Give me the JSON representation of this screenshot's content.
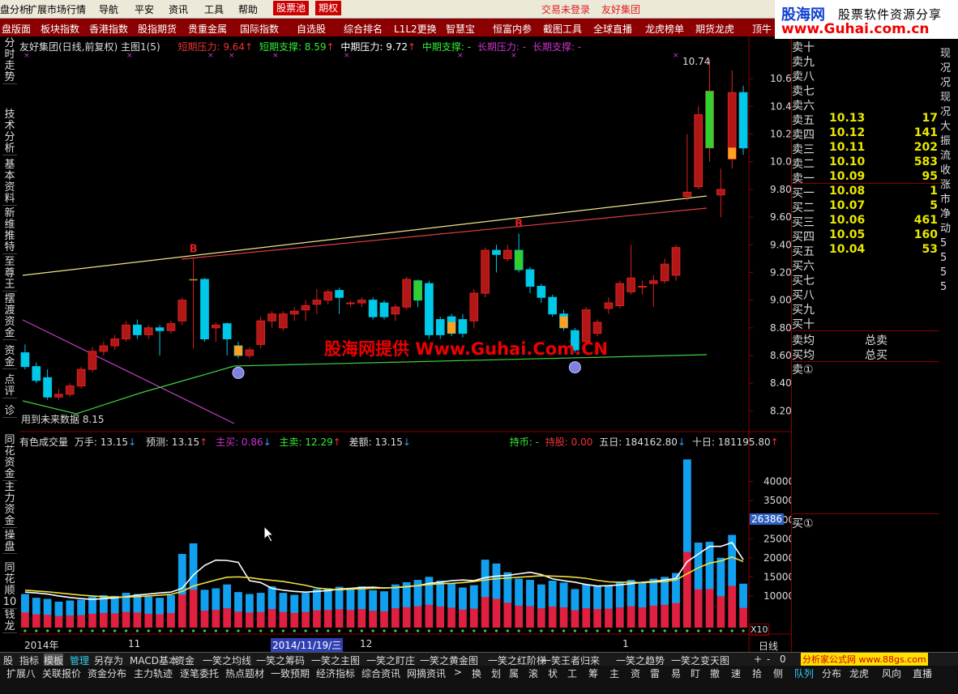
{
  "menubar": {
    "items": [
      "盘分析",
      "扩展市场行情",
      "导航",
      "平安",
      "资讯",
      "工具",
      "帮助",
      "股票池",
      "期权"
    ],
    "status1": "交易未登录",
    "status2": "友好集团"
  },
  "logo": {
    "line1": "股海网",
    "line2": "股票软件资源分享",
    "line3": "www.Guhai.com.cn"
  },
  "tabbar": [
    "盘版面",
    "板块指数",
    "香港指数",
    "股指期货",
    "贵重金属",
    "国际指数",
    "自选股",
    "综合排名",
    "L1L2更换",
    "智慧宝",
    "恒富内参",
    "截图工具",
    "全球直播",
    "龙虎榜单",
    "期货龙虎",
    "顶牛"
  ],
  "leftbar": [
    "分时走势",
    "技术分析",
    "基本资料",
    "新维推特",
    "至尊王",
    "摆渡资金",
    "资金",
    "点评",
    "诊"
  ],
  "leftbar2": [
    "同花资金",
    "主力资金",
    "操盘",
    "同花顺10",
    "钱龙"
  ],
  "chart_header": {
    "title": "友好集团(日线,前复权) 主图1(5)",
    "s1": "短期压力: 9.64",
    "s2": "短期支撑: 8.59",
    "s3": "中期压力: 9.72",
    "s4": "中期支撑: -",
    "s5": "长期压力: -",
    "s6": "长期支撑: -"
  },
  "watermark": "股海网提供 Www.Guhai.Com.CN",
  "bottom_label": "用到未来数据 8.15",
  "max_label": "10.74",
  "b_mark": "B",
  "price_axis": [
    "10.60",
    "10.40",
    "10.20",
    "10.00",
    "9.80",
    "9.60",
    "9.40",
    "9.20",
    "9.00",
    "8.80",
    "8.60",
    "8.40",
    "8.20"
  ],
  "vol_header": {
    "title": "有色成交量",
    "wan": "万手: 13.15",
    "yc": "预测: 13.15",
    "zm": "主买: 0.86",
    "zs": "主卖: 12.29",
    "ce": "差额: 13.15",
    "cb": "持币: -",
    "cg": "持股: 0.00",
    "wr": "五日: 184162.80",
    "sr": "十日: 181195.80"
  },
  "vol_axis": [
    "40000",
    "35000",
    "30000",
    "25000",
    "20000",
    "15000",
    "10000"
  ],
  "vol_tag": "26386",
  "x10": "X10",
  "date_labels": {
    "d1": "2014年",
    "d2": "11",
    "d3": "2014/11/19/三",
    "d4": "12",
    "d5": "1"
  },
  "orderbook": [
    {
      "n": "卖十",
      "p": "",
      "v": ""
    },
    {
      "n": "卖九",
      "p": "",
      "v": ""
    },
    {
      "n": "卖八",
      "p": "",
      "v": ""
    },
    {
      "n": "卖七",
      "p": "",
      "v": ""
    },
    {
      "n": "卖六",
      "p": "",
      "v": ""
    },
    {
      "n": "卖五",
      "p": "10.13",
      "v": "17"
    },
    {
      "n": "卖四",
      "p": "10.12",
      "v": "141"
    },
    {
      "n": "卖三",
      "p": "10.11",
      "v": "202"
    },
    {
      "n": "卖二",
      "p": "10.10",
      "v": "583"
    },
    {
      "n": "卖一",
      "p": "10.09",
      "v": "95"
    },
    {
      "n": "买一",
      "p": "10.08",
      "v": "1"
    },
    {
      "n": "买二",
      "p": "10.07",
      "v": "5"
    },
    {
      "n": "买三",
      "p": "10.06",
      "v": "461"
    },
    {
      "n": "买四",
      "p": "10.05",
      "v": "160"
    },
    {
      "n": "买五",
      "p": "10.04",
      "v": "53"
    },
    {
      "n": "买六",
      "p": "",
      "v": ""
    },
    {
      "n": "买七",
      "p": "",
      "v": ""
    },
    {
      "n": "买八",
      "p": "",
      "v": ""
    },
    {
      "n": "买九",
      "p": "",
      "v": ""
    },
    {
      "n": "买十",
      "p": "",
      "v": ""
    }
  ],
  "avg": {
    "sell": "卖均",
    "buy": "买均",
    "tsell": "总卖",
    "tbuy": "总买",
    "s1": "卖①",
    "b1": "买①"
  },
  "rstrip": "现况况现况大振流收涨市净动5555",
  "bottom1": [
    "股",
    "指标",
    "模板",
    "管理",
    "另存为",
    "MACD基本",
    "资金",
    "一笑之均线",
    "一笑之筹码",
    "一笑之主图",
    "一笑之盯庄",
    "一笑之黄金图",
    "一笑之红阶梯",
    "一笑王者归来",
    "一笑之趋势",
    "一笑之变天图"
  ],
  "bottom1_right": {
    "plus": "+",
    "minus": "-",
    "zero": "0",
    "period": "日线"
  },
  "bottom2": [
    "扩展八",
    "关联报价",
    "资金分布",
    "主力轨迹",
    "逐笔委托",
    "热点题材",
    "一致预期",
    "经济指标",
    "综合资讯",
    "网摘资讯",
    ">",
    "换",
    "划",
    "属",
    "滚",
    "状",
    "工",
    "筹",
    "主",
    "资",
    "雷",
    "易",
    "盯",
    "撤",
    "速",
    "拾",
    "侧",
    "队列",
    "分布",
    "龙虎",
    "风向",
    "直播"
  ],
  "ad": "分析家公式网 www.88gs.com",
  "chart_data": {
    "type": "candlestick",
    "ylim": [
      8.05,
      10.8
    ],
    "candles": [
      [
        8.62,
        8.52,
        8.68,
        8.5
      ],
      [
        8.52,
        8.42,
        8.55,
        8.4
      ],
      [
        8.44,
        8.3,
        8.5,
        8.28
      ],
      [
        8.3,
        8.32,
        8.36,
        8.28
      ],
      [
        8.32,
        8.38,
        8.4,
        8.3
      ],
      [
        8.38,
        8.5,
        8.52,
        8.36
      ],
      [
        8.5,
        8.63,
        8.66,
        8.48
      ],
      [
        8.63,
        8.67,
        8.7,
        8.6
      ],
      [
        8.67,
        8.72,
        8.75,
        8.64
      ],
      [
        8.72,
        8.82,
        8.85,
        8.7
      ],
      [
        8.82,
        8.75,
        8.86,
        8.72
      ],
      [
        8.75,
        8.8,
        8.82,
        8.72
      ],
      [
        8.8,
        8.78,
        8.82,
        8.6
      ],
      [
        8.78,
        8.83,
        8.85,
        8.76
      ],
      [
        8.85,
        9.0,
        9.02,
        8.82
      ],
      [
        9.15,
        9.15,
        9.3,
        8.65
      ],
      [
        9.15,
        8.72,
        9.16,
        8.7
      ],
      [
        8.8,
        8.82,
        8.84,
        8.7
      ],
      [
        8.83,
        8.72,
        8.84,
        8.6
      ],
      [
        8.67,
        8.6,
        8.7,
        8.58
      ],
      [
        8.6,
        8.64,
        8.66,
        8.58
      ],
      [
        8.68,
        8.85,
        8.88,
        8.65
      ],
      [
        8.85,
        8.9,
        8.92,
        8.8
      ],
      [
        8.8,
        8.9,
        8.92,
        8.78
      ],
      [
        8.9,
        8.92,
        8.95,
        8.85
      ],
      [
        8.93,
        8.96,
        9.0,
        8.85
      ],
      [
        8.97,
        9.0,
        9.08,
        8.9
      ],
      [
        9.0,
        9.06,
        9.08,
        8.97
      ],
      [
        9.07,
        9.02,
        9.09,
        8.9
      ],
      [
        8.98,
        8.98,
        9.0,
        8.95
      ],
      [
        8.98,
        9.0,
        9.02,
        8.95
      ],
      [
        9.0,
        8.88,
        9.02,
        8.86
      ],
      [
        8.98,
        8.88,
        9.0,
        8.86
      ],
      [
        8.9,
        8.95,
        8.97,
        8.85
      ],
      [
        8.95,
        9.15,
        9.17,
        8.93
      ],
      [
        9.14,
        9.0,
        9.15,
        8.95
      ],
      [
        9.12,
        8.75,
        9.14,
        8.72
      ],
      [
        8.86,
        8.75,
        8.88,
        8.72
      ],
      [
        8.88,
        8.76,
        8.9,
        8.74
      ],
      [
        8.86,
        8.76,
        8.9,
        8.73
      ],
      [
        8.85,
        9.05,
        9.08,
        8.8
      ],
      [
        9.05,
        9.36,
        9.38,
        9.02
      ],
      [
        9.36,
        9.33,
        9.4,
        9.2
      ],
      [
        9.3,
        9.36,
        9.4,
        9.28
      ],
      [
        9.36,
        9.22,
        9.48,
        9.2
      ],
      [
        9.22,
        9.1,
        9.24,
        9.05
      ],
      [
        9.1,
        9.02,
        9.12,
        8.98
      ],
      [
        9.02,
        8.9,
        9.04,
        8.88
      ],
      [
        8.9,
        8.8,
        8.93,
        8.78
      ],
      [
        8.78,
        8.64,
        8.8,
        8.62
      ],
      [
        8.7,
        8.93,
        8.95,
        8.68
      ],
      [
        8.76,
        8.84,
        8.86,
        8.74
      ],
      [
        8.94,
        8.98,
        9.02,
        8.9
      ],
      [
        8.96,
        9.12,
        9.14,
        8.94
      ],
      [
        9.06,
        9.16,
        9.4,
        9.04
      ],
      [
        9.1,
        9.1,
        9.14,
        9.04
      ],
      [
        9.12,
        9.14,
        9.18,
        8.95
      ],
      [
        9.14,
        9.26,
        9.3,
        9.12
      ],
      [
        9.18,
        9.38,
        9.4,
        9.14
      ],
      [
        9.75,
        9.78,
        10.2,
        9.72
      ],
      [
        9.82,
        10.34,
        10.4,
        9.8
      ],
      [
        10.1,
        10.51,
        10.74,
        10.0
      ],
      [
        9.76,
        9.8,
        9.95,
        9.6
      ],
      [
        10.02,
        10.5,
        10.66,
        9.95
      ],
      [
        10.5,
        10.1,
        10.55,
        10.05
      ]
    ],
    "volume": [
      10500,
      9500,
      9200,
      8500,
      8800,
      9000,
      9800,
      10200,
      10000,
      10800,
      10500,
      9800,
      9500,
      10200,
      21000,
      23800,
      11600,
      12000,
      13000,
      11000,
      10500,
      10800,
      12500,
      10800,
      10300,
      10800,
      11800,
      12000,
      12400,
      12000,
      12500,
      11500,
      11200,
      13000,
      13600,
      14200,
      15000,
      14000,
      13300,
      12200,
      12800,
      19500,
      18500,
      16200,
      14500,
      14200,
      13000,
      14000,
      13500,
      11800,
      13000,
      12500,
      12800,
      13500,
      14200,
      13500,
      14500,
      15000,
      16000,
      45800,
      24000,
      24200,
      20000,
      26000,
      13200
    ],
    "ma5_vol": [
      11000,
      10800,
      10500,
      10000,
      9600,
      9300,
      9100,
      9300,
      9500,
      9800,
      10200,
      10500,
      10800,
      11000,
      12000,
      15500,
      18000,
      19400,
      19300,
      18800,
      14000,
      13500,
      12000,
      11500,
      11200,
      11000,
      11200,
      11400,
      11800,
      12000,
      12200,
      12300,
      12100,
      12200,
      12400,
      12700,
      13300,
      13600,
      14000,
      14200,
      14000,
      14800,
      15200,
      15400,
      15800,
      16200,
      15600,
      14500,
      14000,
      13600,
      13000,
      12600,
      12700,
      12900,
      13200,
      13600,
      13800,
      14200,
      14600,
      19000,
      21000,
      23000,
      23000,
      24000,
      19500
    ],
    "ma10_vol": [
      11500,
      11300,
      11100,
      10800,
      10500,
      10200,
      10000,
      9800,
      9700,
      9700,
      9800,
      10000,
      10200,
      10400,
      11200,
      12600,
      13400,
      14200,
      14900,
      15000,
      14800,
      14400,
      14100,
      13800,
      13300,
      12800,
      12100,
      11800,
      11600,
      11800,
      11900,
      12000,
      12100,
      12200,
      12500,
      12700,
      13000,
      13200,
      13300,
      13500,
      13800,
      14200,
      14500,
      14700,
      14900,
      15100,
      15300,
      15200,
      15100,
      14900,
      14600,
      14100,
      13700,
      13600,
      13600,
      13500,
      13600,
      13800,
      14200,
      15800,
      17400,
      18600,
      19200,
      20200,
      19000
    ]
  }
}
